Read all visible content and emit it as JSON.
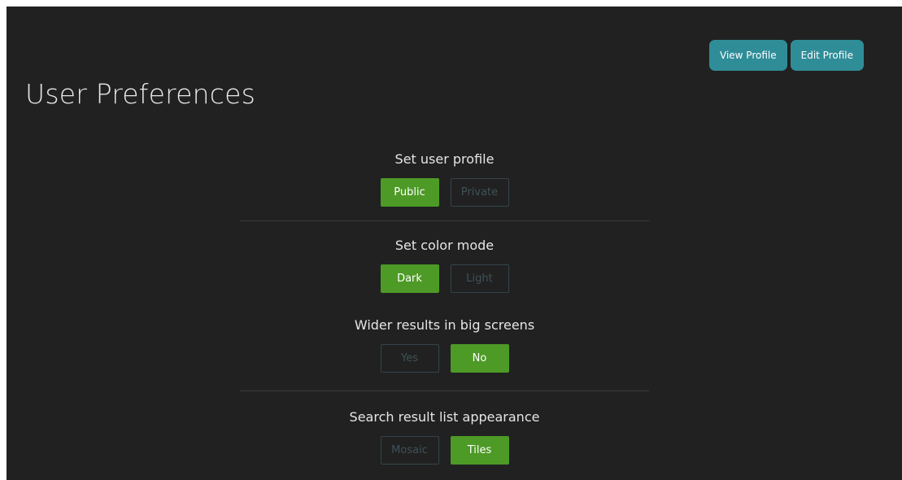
{
  "header": {
    "title": "User Preferences",
    "view_profile_label": "View Profile",
    "edit_profile_label": "Edit Profile"
  },
  "preferences": {
    "profile_visibility": {
      "label": "Set user profile",
      "options": [
        "Public",
        "Private"
      ],
      "selected": "Public"
    },
    "color_mode": {
      "label": "Set color mode",
      "options": [
        "Dark",
        "Light"
      ],
      "selected": "Dark"
    },
    "wider_results": {
      "label": "Wider results in big screens",
      "options": [
        "Yes",
        "No"
      ],
      "selected": "No"
    },
    "list_appearance": {
      "label": "Search result list appearance",
      "options": [
        "Mosaic",
        "Tiles"
      ],
      "selected": "Tiles"
    }
  },
  "colors": {
    "background": "#212121",
    "accent_teal": "#2f8d98",
    "active_green": "#4d9a26",
    "inactive_border": "#33454b",
    "inactive_text": "#3e5258"
  }
}
